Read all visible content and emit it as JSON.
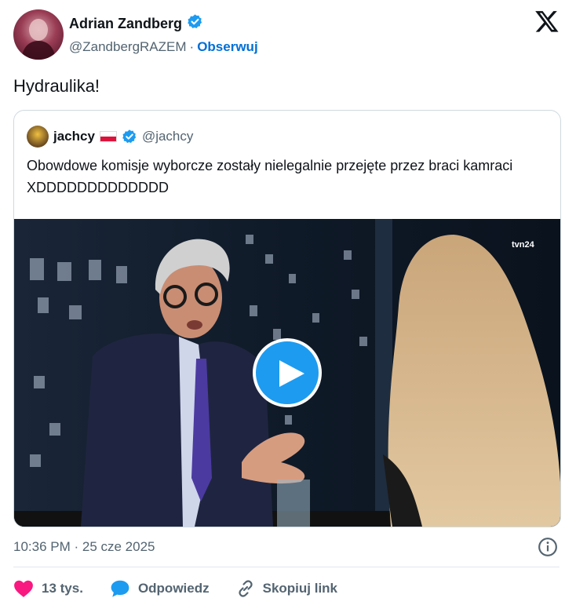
{
  "author": {
    "name": "Adrian Zandberg",
    "handle": "@ZandbergRAZEM",
    "separator": "·",
    "follow_label": "Obserwuj"
  },
  "tweet": {
    "text": "Hydraulika!",
    "timestamp": "10:36 PM · 25 cze 2025"
  },
  "quoted": {
    "name": "jachcy",
    "handle": "@jachcy",
    "text": "Obowdowe komisje wyborcze zostały nielegalnie przejęte przez braci kamraci XDDDDDDDDDDDDD",
    "media_channel": "tvn24"
  },
  "actions": {
    "like_count": "13 tys.",
    "reply_label": "Odpowiedz",
    "copy_label": "Skopiuj link"
  },
  "colors": {
    "verified": "#1d9bf0",
    "follow": "#006fd6",
    "like": "#f91880",
    "reply": "#1d9bf0"
  },
  "icons": [
    "x-logo-icon",
    "verified-badge-icon",
    "flag-poland-icon",
    "play-icon",
    "info-icon",
    "heart-icon",
    "reply-bubble-icon",
    "link-icon"
  ]
}
